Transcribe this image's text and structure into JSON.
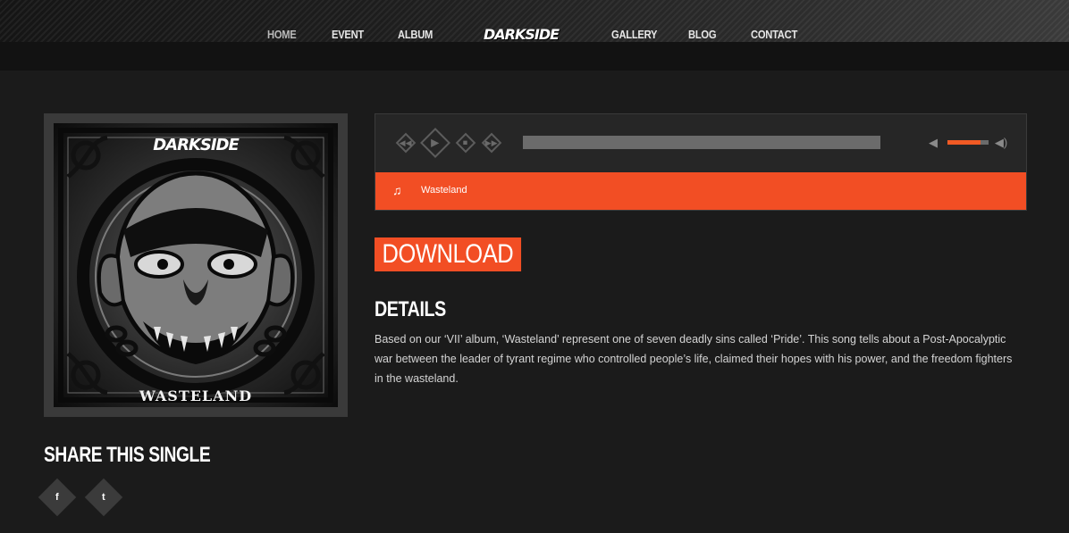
{
  "header": {
    "nav_left": [
      "HOME",
      "EVENT",
      "ALBUM"
    ],
    "logo": "DARKSIDE",
    "nav_right": [
      "GALLERY",
      "BLOG",
      "CONTACT"
    ],
    "active": "HOME"
  },
  "cover": {
    "brand": "DARKSIDE",
    "title": "WASTELAND"
  },
  "player": {
    "buttons": [
      "rewind-icon",
      "play-icon",
      "stop-icon",
      "fast-forward-icon"
    ],
    "progress": 0,
    "volume": 0.8,
    "track_icon": "music-note-icon",
    "track_name": "Wasteland"
  },
  "download_label": "DOWNLOAD",
  "details": {
    "title": "DETAILS",
    "text": "Based on our ‘VII’ album, ‘Wasteland’ represent one of seven deadly sins called ‘Pride’. This song tells about a Post-Apocalyptic war between the leader of tyrant regime who controlled people’s life, claimed their hopes with his power, and the freedom fighters in the wasteland."
  },
  "share": {
    "title": "SHARE THIS SINGLE",
    "facebook": "f",
    "twitter": "t"
  },
  "colors": {
    "accent": "#f24e24",
    "background": "#1b1b1b",
    "header": "#121212"
  }
}
